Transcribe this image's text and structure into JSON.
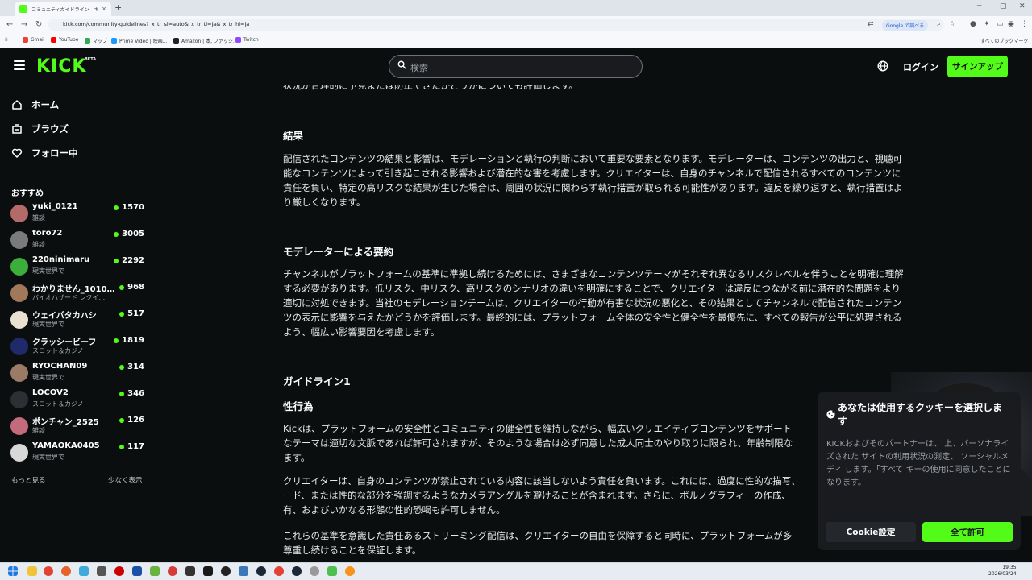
{
  "browser": {
    "tab_title": "コミュニティガイドライン - キックストリ...",
    "tab_close": "×",
    "new_tab": "+",
    "url": "kick.com/community-guidelines?_x_tr_sl=auto&_x_tr_tl=ja&_x_tr_hl=ja",
    "translate_badge": "Google で調べる",
    "bookmarks": [
      {
        "label": "Gmail",
        "color": "#ea4335"
      },
      {
        "label": "YouTube",
        "color": "#ff0000"
      },
      {
        "label": "マップ",
        "color": "#34a853"
      },
      {
        "label": "Prime Video | 映画...",
        "color": "#1a98ff"
      },
      {
        "label": "Amazon | 本, ファッシ...",
        "color": "#222222"
      },
      {
        "label": "Twitch",
        "color": "#9146ff"
      }
    ],
    "all_bookmarks": "すべてのブックマーク"
  },
  "header": {
    "logo": "KICK",
    "beta": "BETA",
    "search_placeholder": "検索",
    "login": "ログイン",
    "signup": "サインアップ"
  },
  "sidebar": {
    "nav": [
      {
        "label": "ホーム",
        "icon": "home-icon"
      },
      {
        "label": "ブラウズ",
        "icon": "browse-icon"
      },
      {
        "label": "フォロー中",
        "icon": "heart-icon"
      }
    ],
    "recommended_title": "おすすめ",
    "channels": [
      {
        "name": "yuki_0121",
        "category": "雑談",
        "viewers": "1570",
        "avatar": "#b56a6a"
      },
      {
        "name": "toro72",
        "category": "雑談",
        "viewers": "3005",
        "avatar": "#7a7a7a"
      },
      {
        "name": "220ninimaru",
        "category": "現実世界で",
        "viewers": "2292",
        "avatar": "#3cae3c"
      },
      {
        "name": "わかりません_10101...",
        "category": "バイオハザード レクイ...",
        "viewers": "968",
        "avatar": "#a0785a"
      },
      {
        "name": "ウェイパタカハシ",
        "category": "現実世界で",
        "viewers": "517",
        "avatar": "#e8e0d0"
      },
      {
        "name": "クラッシービーフ",
        "category": "スロット＆カジノ",
        "viewers": "1819",
        "avatar": "#1f2a6b"
      },
      {
        "name": "RYOCHAN09",
        "category": "現実世界で",
        "viewers": "314",
        "avatar": "#9c7b66"
      },
      {
        "name": "LOCOV2",
        "category": "スロット＆カジノ",
        "viewers": "346",
        "avatar": "#2e2e35"
      },
      {
        "name": "ポンチャン_2525",
        "category": "雑談",
        "viewers": "126",
        "avatar": "#c46a7d"
      },
      {
        "name": "YAMAOKA0405",
        "category": "現実世界で",
        "viewers": "117",
        "avatar": "#d8d8d8"
      }
    ],
    "show_more": "もっと見る",
    "show_less": "少なく表示"
  },
  "content": {
    "top_line": "状況が合理的に予見または防止できたかどうかについても評価します。",
    "h_result": "結果",
    "p_result": "配信されたコンテンツの結果と影響は、モデレーションと執行の判断において重要な要素となります。モデレーターは、コンテンツの出力と、視聴可能なコンテンツによって引き起こされる影響および潜在的な害を考慮します。クリエイターは、自身のチャンネルで配信されるすべてのコンテンツに責任を負い、特定の高リスクな結果が生じた場合は、周囲の状況に関わらず執行措置が取られる可能性があります。違反を繰り返すと、執行措置はより厳しくなります。",
    "h_summary": "モデレーターによる要約",
    "p_summary": "チャンネルがプラットフォームの基準に準拠し続けるためには、さまざまなコンテンツテーマがそれぞれ異なるリスクレベルを伴うことを明確に理解する必要があります。低リスク、中リスク、高リスクのシナリオの違いを明確にすることで、クリエイターは違反につながる前に潜在的な問題をより適切に対処できます。当社のモデレーションチームは、クリエイターの行動が有害な状況の悪化と、その結果としてチャンネルで配信されたコンテンツの表示に影響を与えたかどうかを評価します。最終的には、プラットフォーム全体の安全性と健全性を最優先に、すべての報告が公平に処理されるよう、幅広い影響要因を考慮します。",
    "h_guideline1": "ガイドライン1",
    "h_sexual": "性行為",
    "p_sexual_1": "Kickは、プラットフォームの安全性とコミュニティの健全性を維持しながら、幅広いクリエイティブコンテンツをサポート",
    "p_sexual_2": "なテーマは適切な文脈であれば許可されますが、そのような場合は必ず同意した成人同士のやり取りに限られ、年齢制限な",
    "p_sexual_3": "ます。",
    "p_creator_1": "クリエイターは、自身のコンテンツが禁止されている内容に該当しないよう責任を負います。これには、過度に性的な描写、",
    "p_creator_2": "ード、または性的な部分を強調するようなカメラアングルを避けることが含まれます。さらに、ポルノグラフィーの作成、",
    "p_creator_3": "有、およびいかなる形態の性的恐喝も許可しません。",
    "p_standards_1": "これらの基準を意識した責任あるストリーミング配信は、クリエイターの自由を保障すると同時に、プラットフォームが多",
    "p_standards_2": "尊重し続けることを保証します。"
  },
  "cookie": {
    "title": "あなたは使用するクッキーを選択しま す",
    "body": "KICKおよびそのパートナーは、 上、パーソナライズされた サイトの利用状況の測定、 ソーシャルメディ します。「すべて キーの使用に同意したことになります。",
    "settings": "Cookie設定",
    "accept": "全て許可"
  },
  "taskbar": {
    "time": "19:35",
    "date": "2026/03/24"
  },
  "colors": {
    "accent": "#53fc18",
    "background": "#0b0e0f"
  }
}
